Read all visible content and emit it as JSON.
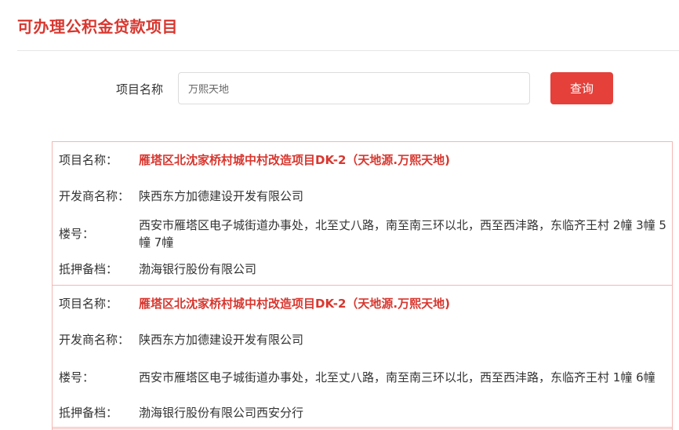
{
  "page": {
    "title": "可办理公积金贷款项目"
  },
  "search": {
    "label": "项目名称",
    "input_value": "万熙天地",
    "button_label": "查询"
  },
  "field_labels": {
    "project": "项目名称：",
    "developer": "开发商名称：",
    "building": "楼号：",
    "mortgage": "抵押备档："
  },
  "results": [
    {
      "project": "雁塔区北沈家桥村城中村改造项目DK-2（天地源.万熙天地)",
      "developer": "陕西东方加德建设开发有限公司",
      "building": "西安市雁塔区电子城街道办事处，北至丈八路，南至南三环以北，西至西沣路，东临齐王村 2幢 3幢 5幢 7幢",
      "mortgage": "渤海银行股份有限公司"
    },
    {
      "project": "雁塔区北沈家桥村城中村改造项目DK-2（天地源.万熙天地)",
      "developer": "陕西东方加德建设开发有限公司",
      "building": "西安市雁塔区电子城街道办事处，北至丈八路，南至南三环以北，西至西沣路，东临齐王村 1幢 6幢",
      "mortgage": "渤海银行股份有限公司西安分行"
    }
  ]
}
